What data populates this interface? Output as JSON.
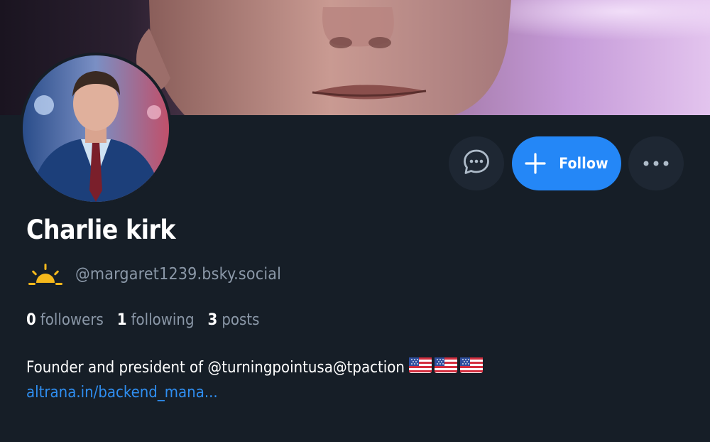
{
  "profile": {
    "display_name": "Charlie kirk",
    "handle": "@margaret1239.bsky.social",
    "bio": "Founder and president of @turningpointusa@tpaction",
    "link": "altrana.in/backend_mana...",
    "flag_icons": [
      "us-flag-icon",
      "us-flag-icon",
      "us-flag-icon"
    ],
    "handle_icon": "sun-icon"
  },
  "stats": {
    "followers_count": "0",
    "followers_label": "followers",
    "following_count": "1",
    "following_label": "following",
    "posts_count": "3",
    "posts_label": "posts"
  },
  "actions": {
    "message_icon": "message-icon",
    "follow_label": "Follow",
    "follow_icon": "plus-icon",
    "more_icon": "ellipsis-icon"
  },
  "colors": {
    "background": "#161e27",
    "follow_button": "#2487f7",
    "secondary_button": "#1e2733",
    "muted_text": "#8b98a8",
    "link": "#2f8ef0",
    "sun": "#f5b81c"
  }
}
